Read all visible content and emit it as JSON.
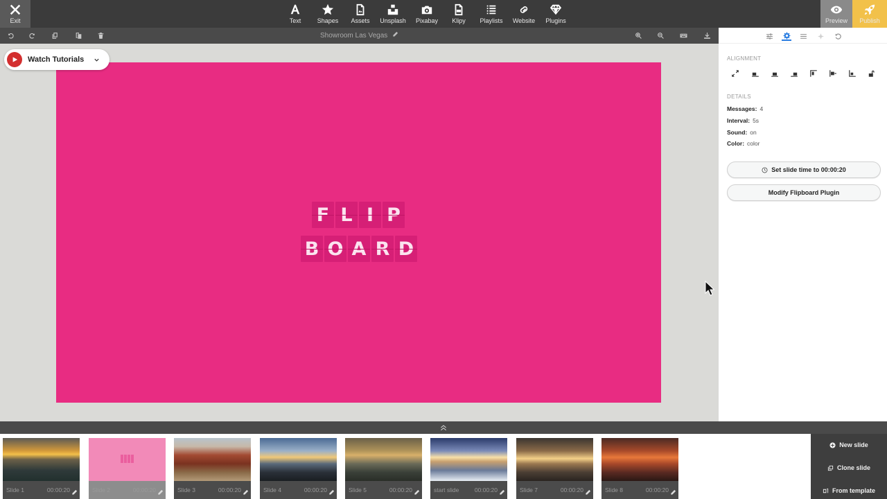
{
  "toolbar": {
    "exit": "Exit",
    "tools": [
      {
        "label": "Text",
        "icon": "text-icon"
      },
      {
        "label": "Shapes",
        "icon": "star-icon"
      },
      {
        "label": "Assets",
        "icon": "assets-icon"
      },
      {
        "label": "Unsplash",
        "icon": "unsplash-icon"
      },
      {
        "label": "Pixabay",
        "icon": "camera-icon"
      },
      {
        "label": "Klipy",
        "icon": "gif-icon"
      },
      {
        "label": "Playlists",
        "icon": "list-icon"
      },
      {
        "label": "Website",
        "icon": "link-icon"
      },
      {
        "label": "Plugins",
        "icon": "diamond-icon"
      }
    ],
    "preview": "Preview",
    "publish": "Publish"
  },
  "document": {
    "title": "Showroom Las Vegas"
  },
  "tutorials": {
    "label": "Watch Tutorials"
  },
  "canvas": {
    "background": "#e82c82",
    "logo_rows": [
      [
        "F",
        "L",
        "I",
        "P"
      ],
      [
        "B",
        "O",
        "A",
        "R",
        "D"
      ]
    ]
  },
  "panel": {
    "alignment_label": "ALIGNMENT",
    "details_label": "DETAILS",
    "details": [
      {
        "key": "Messages:",
        "value": "4"
      },
      {
        "key": "Interval:",
        "value": "5s"
      },
      {
        "key": "Sound:",
        "value": "on"
      },
      {
        "key": "Color:",
        "value": "color"
      }
    ],
    "set_time_button": "Set slide time to 00:00:20",
    "modify_plugin_button": "Modify Flipboard Plugin"
  },
  "slides": [
    {
      "label": "Slide 1",
      "time": "00:00:20"
    },
    {
      "label": "Slide 2",
      "time": "00:00:20"
    },
    {
      "label": "Slide 3",
      "time": "00:00:20"
    },
    {
      "label": "Slide 4",
      "time": "00:00:20"
    },
    {
      "label": "Slide 5",
      "time": "00:00:20"
    },
    {
      "label": "start slide",
      "time": "00:00:20"
    },
    {
      "label": "Slide 7",
      "time": "00:00:20"
    },
    {
      "label": "Slide 8",
      "time": "00:00:20"
    }
  ],
  "slide_actions": {
    "new": "New slide",
    "clone": "Clone slide",
    "template": "From template"
  },
  "colors": {
    "accent_publish": "#f2c14a",
    "toolbar": "#3b3b3b",
    "slide_pink": "#e82c82"
  }
}
